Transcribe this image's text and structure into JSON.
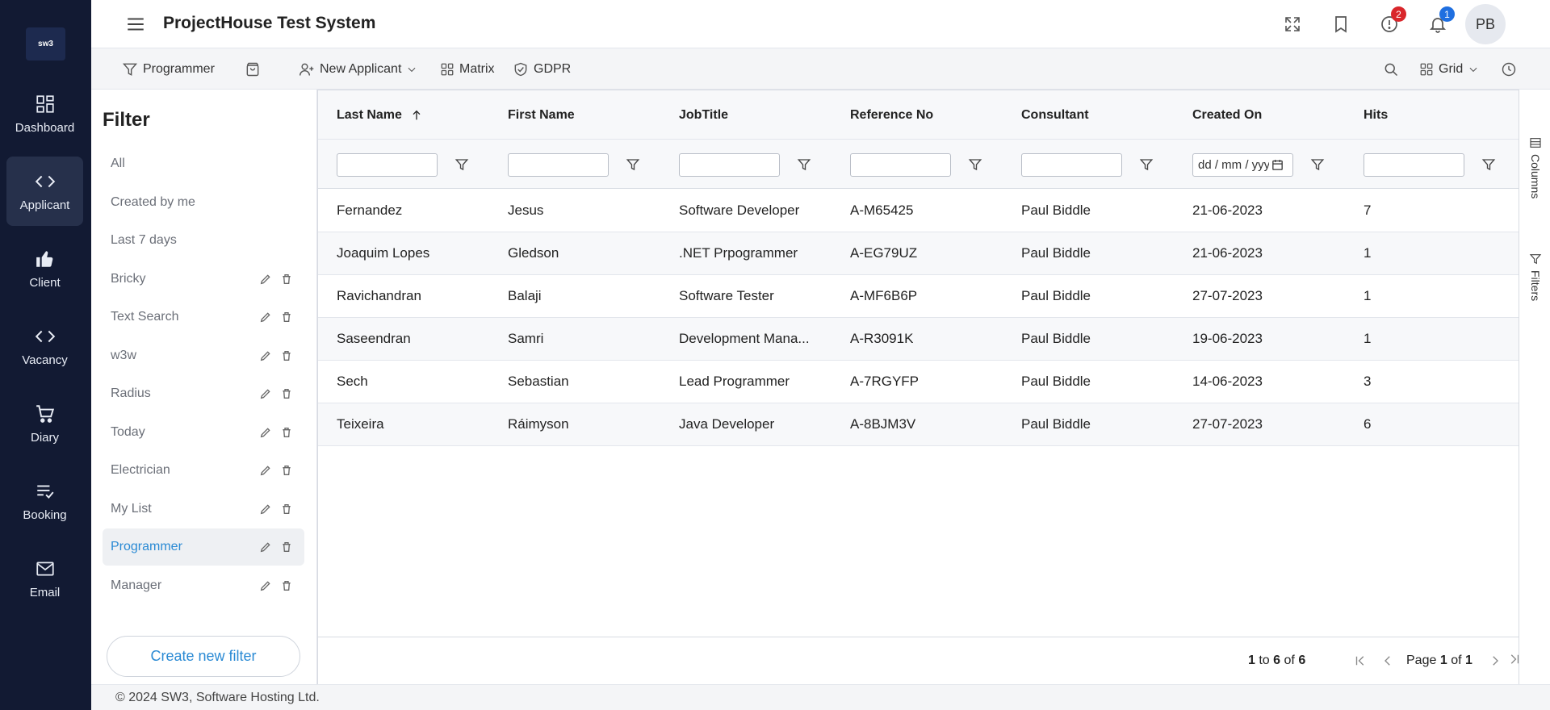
{
  "app": {
    "logo_text": "sw3",
    "title": "ProjectHouse Test System"
  },
  "leftnav": [
    {
      "label": "Dashboard",
      "icon": "dashboard-icon",
      "active": false
    },
    {
      "label": "Applicant",
      "icon": "code-icon",
      "active": true
    },
    {
      "label": "Client",
      "icon": "thumbs-up-icon",
      "active": false
    },
    {
      "label": "Vacancy",
      "icon": "code-icon",
      "active": false
    },
    {
      "label": "Diary",
      "icon": "cart-icon",
      "active": false
    },
    {
      "label": "Booking",
      "icon": "list-check-icon",
      "active": false
    },
    {
      "label": "Email",
      "icon": "envelope-icon",
      "active": false
    }
  ],
  "header": {
    "alerts_badge": "2",
    "notifications_badge": "1",
    "avatar_initials": "PB",
    "alert_badge_color": "#d9262b",
    "notify_badge_color": "#1f6fe0"
  },
  "toolbar": {
    "filter_label": "Programmer",
    "new_applicant_label": "New Applicant",
    "matrix_label": "Matrix",
    "gdpr_label": "GDPR",
    "view_label": "Grid"
  },
  "filter_panel": {
    "title": "Filter",
    "items": [
      {
        "label": "All",
        "editable": false,
        "active": false
      },
      {
        "label": "Created by me",
        "editable": false,
        "active": false
      },
      {
        "label": "Last 7 days",
        "editable": false,
        "active": false
      },
      {
        "label": "Bricky",
        "editable": true,
        "active": false
      },
      {
        "label": "Text Search",
        "editable": true,
        "active": false
      },
      {
        "label": "w3w",
        "editable": true,
        "active": false
      },
      {
        "label": "Radius",
        "editable": true,
        "active": false
      },
      {
        "label": "Today",
        "editable": true,
        "active": false
      },
      {
        "label": "Electrician",
        "editable": true,
        "active": false
      },
      {
        "label": "My List",
        "editable": true,
        "active": false
      },
      {
        "label": "Programmer",
        "editable": true,
        "active": true
      },
      {
        "label": "Manager",
        "editable": true,
        "active": false
      }
    ],
    "create_label": "Create new filter"
  },
  "grid": {
    "columns": [
      "Last Name",
      "First Name",
      "JobTitle",
      "Reference No",
      "Consultant",
      "Created On",
      "Hits"
    ],
    "date_placeholder": "dd / mm / yyyy",
    "rows": [
      [
        "Fernandez",
        "Jesus",
        "Software Developer",
        "A-M65425",
        "Paul Biddle",
        "21-06-2023",
        "7"
      ],
      [
        "Joaquim Lopes",
        "Gledson",
        ".NET Prpogrammer",
        "A-EG79UZ",
        "Paul Biddle",
        "21-06-2023",
        "1"
      ],
      [
        "Ravichandran",
        "Balaji",
        "Software Tester",
        "A-MF6B6P",
        "Paul Biddle",
        "27-07-2023",
        "1"
      ],
      [
        "Saseendran",
        "Samri",
        "Development Mana...",
        "A-R3091K",
        "Paul Biddle",
        "19-06-2023",
        "1"
      ],
      [
        "Sech",
        "Sebastian",
        "Lead Programmer",
        "A-7RGYFP",
        "Paul Biddle",
        "14-06-2023",
        "3"
      ],
      [
        "Teixeira",
        "Ráimyson",
        "Java Developer",
        "A-8BJM3V",
        "Paul Biddle",
        "27-07-2023",
        "6"
      ]
    ],
    "pager": {
      "range_from": "1",
      "range_to_word": "to",
      "range_to": "6",
      "of_word": "of",
      "total": "6",
      "page_word": "Page",
      "page": "1",
      "pages": "1"
    }
  },
  "side_tabs": {
    "columns": "Columns",
    "filters": "Filters"
  },
  "footer": {
    "copyright": "© 2024 SW3, Software Hosting Ltd."
  }
}
